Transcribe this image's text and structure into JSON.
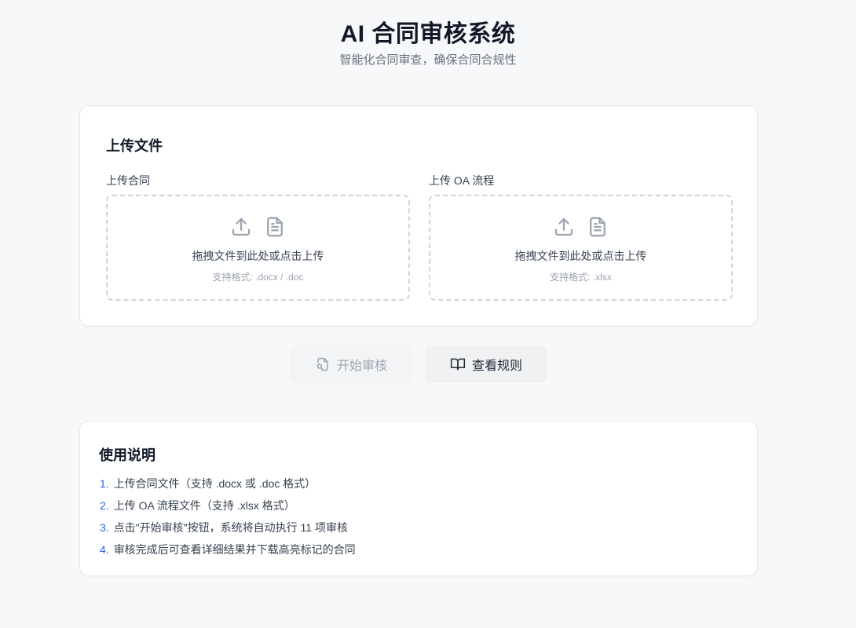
{
  "header": {
    "title": "AI 合同审核系统",
    "subtitle": "智能化合同审查，确保合同合规性"
  },
  "upload": {
    "section_title": "上传文件",
    "contract": {
      "label": "上传合同",
      "prompt": "拖拽文件到此处或点击上传",
      "formats": "支持格式: .docx / .doc"
    },
    "oa": {
      "label": "上传 OA 流程",
      "prompt": "拖拽文件到此处或点击上传",
      "formats": "支持格式: .xlsx"
    }
  },
  "actions": {
    "start_label": "开始审核",
    "rules_label": "查看规则",
    "start_enabled": false
  },
  "help": {
    "title": "使用说明",
    "items": [
      {
        "num": "1.",
        "text": "上传合同文件（支持 .docx 或 .doc 格式）"
      },
      {
        "num": "2.",
        "text": "上传 OA 流程文件（支持 .xlsx 格式）"
      },
      {
        "num": "3.",
        "text": "点击\"开始审核\"按钮，系统将自动执行 11 项审核"
      },
      {
        "num": "4.",
        "text": "审核完成后可查看详细结果并下载高亮标记的合同"
      }
    ]
  },
  "colors": {
    "background": "#f7f8fa",
    "accent": "#2563eb",
    "muted_text": "#9ca3af",
    "dashed_border": "#d1d5db"
  }
}
